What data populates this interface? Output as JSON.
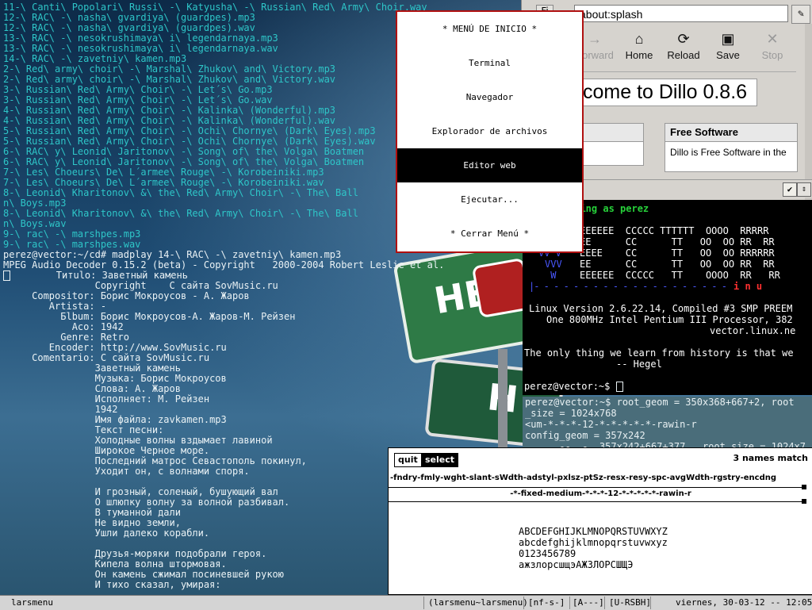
{
  "terminal": {
    "lines": [
      {
        "text": "11-\\ Canti\\ Popolari\\ Russi\\ -\\ Katyusha\\ -\\ Russian\\ Red\\ Army\\ Choir.wav",
        "color": "cyan"
      },
      {
        "text": "12-\\ RAC\\ -\\ nasha\\ gvardiya\\ (guardpes).mp3",
        "color": "cyan"
      },
      {
        "text": "12-\\ RAC\\ -\\ nasha\\ gvardiya\\ (guardpes).wav",
        "color": "cyan"
      },
      {
        "text": "13-\\ RAC\\ -\\ nesokrushimaya\\ i\\ legendarnaya.mp3",
        "color": "cyan"
      },
      {
        "text": "13-\\ RAC\\ -\\ nesokrushimaya\\ i\\ legendarnaya.wav",
        "color": "cyan"
      },
      {
        "text": "14-\\ RAC\\ -\\ zavetniy\\ kamen.mp3",
        "color": "cyan"
      },
      {
        "text": "2-\\ Red\\ army\\ choir\\ -\\ Marshal\\ Zhukov\\ and\\ Victory.mp3",
        "color": "cyan"
      },
      {
        "text": "2-\\ Red\\ army\\ choir\\ -\\ Marshal\\ Zhukov\\ and\\ Victory.wav",
        "color": "cyan"
      },
      {
        "text": "3-\\ Russian\\ Red\\ Army\\ Choir\\ -\\ Let´s\\ Go.mp3",
        "color": "cyan"
      },
      {
        "text": "3-\\ Russian\\ Red\\ Army\\ Choir\\ -\\ Let´s\\ Go.wav",
        "color": "cyan"
      },
      {
        "text": "4-\\ Russian\\ Red\\ Army\\ Choir\\ -\\ Kalinka\\ (Wonderful).mp3",
        "color": "cyan"
      },
      {
        "text": "4-\\ Russian\\ Red\\ Army\\ Choir\\ -\\ Kalinka\\ (Wonderful).wav",
        "color": "cyan"
      },
      {
        "text": "5-\\ Russian\\ Red\\ Army\\ Choir\\ -\\ Ochi\\ Chornye\\ (Dark\\ Eyes).mp3",
        "color": "cyan"
      },
      {
        "text": "5-\\ Russian\\ Red\\ Army\\ Choir\\ -\\ Ochi\\ Chornye\\ (Dark\\ Eyes).wav",
        "color": "cyan"
      },
      {
        "text": "6-\\ RAC\\ y\\ Leonid\\ Jaritonov\\ -\\ Song\\ of\\ the\\ Volga\\ Boatmen",
        "color": "cyan"
      },
      {
        "text": "6-\\ RAC\\ y\\ Leonid\\ Jaritonov\\ -\\ Song\\ of\\ the\\ Volga\\ Boatmen",
        "color": "cyan"
      },
      {
        "text": "7-\\ Les\\ Choeurs\\ De\\ L´armee\\ Rouge\\ -\\ Korobeiniki.mp3",
        "color": "cyan"
      },
      {
        "text": "7-\\ Les\\ Choeurs\\ De\\ L´armee\\ Rouge\\ -\\ Korobeiniki.wav",
        "color": "cyan"
      },
      {
        "text": "8-\\ Leonid\\ Kharitonov\\ &\\ the\\ Red\\ Army\\ Choir\\ -\\ The\\ Ball",
        "color": "cyan"
      },
      {
        "text": "n\\ Boys.mp3",
        "color": "cyan"
      },
      {
        "text": "8-\\ Leonid\\ Kharitonov\\ &\\ the\\ Red\\ Army\\ Choir\\ -\\ The\\ Ball",
        "color": "cyan"
      },
      {
        "text": "n\\ Boys.wav",
        "color": "cyan"
      },
      {
        "text": "9-\\ rac\\ -\\ marshpes.mp3",
        "color": "cyan"
      },
      {
        "text": "9-\\ rac\\ -\\ marshpes.wav",
        "color": "cyan"
      },
      {
        "text": "perez@vector:~/cd# madplay 14-\\ RAC\\ -\\ zavetniy\\ kamen.mp3",
        "color": "white"
      },
      {
        "text": "MPEG Audio Decoder 0.15.2 (beta) - Copyright   2000-2004 Robert Leslie et al.",
        "color": "white"
      },
      {
        "text": "        Титulo: Заветный камень",
        "color": "white",
        "cursor": true
      },
      {
        "text": "                Copyright    С сайта SovMusic.ru",
        "color": "white"
      },
      {
        "text": "     Compositor: Борис Мокроусов - А. Жаров",
        "color": "white"
      },
      {
        "text": "        Artista: -",
        "color": "white"
      },
      {
        "text": "          Бlbum: Борис Мокроусов-А. Жаров-М. Рейзен",
        "color": "white"
      },
      {
        "text": "            Aco: 1942",
        "color": "white"
      },
      {
        "text": "          Genre: Retro",
        "color": "white"
      },
      {
        "text": "        Encoder: http://www.SovMusic.ru",
        "color": "white"
      },
      {
        "text": "     Comentario: С сайта SovMusic.ru",
        "color": "white"
      },
      {
        "text": "                Заветный камень",
        "color": "white"
      },
      {
        "text": "                Музыка: Борис Мокроусов",
        "color": "white"
      },
      {
        "text": "                Слова: А. Жаров",
        "color": "white"
      },
      {
        "text": "                Исполняет: М. Рейзен",
        "color": "white"
      },
      {
        "text": "                1942",
        "color": "white"
      },
      {
        "text": "                Имя файла: zavkamen.mp3",
        "color": "white"
      },
      {
        "text": "                Текст песни:",
        "color": "white"
      },
      {
        "text": "                Холодные волны вздымает лавиной",
        "color": "white"
      },
      {
        "text": "                Широкое Черное море.",
        "color": "white"
      },
      {
        "text": "                Последний матрос Севастополь покинул,",
        "color": "white"
      },
      {
        "text": "                Уходит он, с волнами споря.",
        "color": "white"
      },
      {
        "text": "",
        "color": "white"
      },
      {
        "text": "                И грозный, соленый, бушующий вал",
        "color": "white"
      },
      {
        "text": "                О шлюпку волну за волной разбивал.",
        "color": "white"
      },
      {
        "text": "                В туманной дали",
        "color": "white"
      },
      {
        "text": "                Не видно земли,",
        "color": "white"
      },
      {
        "text": "                Ушли далеко корабли.",
        "color": "white"
      },
      {
        "text": "",
        "color": "white"
      },
      {
        "text": "                Друзья-моряки подобрали героя.",
        "color": "white"
      },
      {
        "text": "                Кипела волна штормовая.",
        "color": "white"
      },
      {
        "text": "                Он камень сжимал посиневшей рукою",
        "color": "white"
      },
      {
        "text": "                И тихо сказал, умирая:",
        "color": "white"
      }
    ]
  },
  "dillo": {
    "menu_label": "Fi",
    "url": "about:splash",
    "clear_icon": "✎",
    "toolbar": [
      {
        "label": "Forward",
        "icon": "→",
        "disabled": true
      },
      {
        "label": "Home",
        "icon": "⌂",
        "disabled": false
      },
      {
        "label": "Reload",
        "icon": "⟳",
        "disabled": false
      },
      {
        "label": "Save",
        "icon": "▣",
        "disabled": false
      },
      {
        "label": "Stop",
        "icon": "✕",
        "disabled": true
      }
    ],
    "welcome": "come to Dillo 0.8.6",
    "free_software_title": "Free Software",
    "free_software_text": "Dillo is Free Software in the",
    "status_check": "✔",
    "status_updown": "⇕"
  },
  "xterm": {
    "working": "rking as perez",
    "banner": [
      "EEEEEE  CCCCC TTTTTT  OOOO  RRRRR",
      "EE      CC      TT   OO  OO RR  RR",
      "EEEE    CC      TT   OO  OO RRRRRR",
      "EE      CC      TT   OO  OO RR  RR",
      "EEEEEE  CCCCC   TT    OOOO  RR   RR"
    ],
    "vv": [
      "V  V",
      "VV V",
      "VVV",
      " W"
    ],
    "linux_row": "i n u",
    "version": "Linux Version 2.6.22.14, Compiled #3 SMP PREEM",
    "cpu": "One 800MHz Intel Pentium III Processor, 382",
    "host": "vector.linux.ne",
    "quote1": "The only thing we learn from history is that we",
    "quote2": "-- Hegel",
    "prompt": "perez@vector:~$ "
  },
  "xterm2": {
    "lines": [
      "perez@vector:~$ root_geom = 350x368+667+2, root",
      "_size = 1024x768",
      "<um-*-*-*-12-*-*-*-*-*-rawin-r",
      "config_geom = 357x242",
      "      --  -  357x242+667+377 . root_size = 1024x7"
    ]
  },
  "xfontsel": {
    "quit": "quit",
    "select": "select",
    "match": "3 names match",
    "pattern": "-fndry-fmly-wght-slant-sWdth-adstyl-pxlsz-ptSz-resx-resy-spc-avgWdth-rgstry-encdng",
    "fontname": "-*-fixed-medium-*-*-*-12-*-*-*-*-*-rawin-r",
    "sample": [
      "ABCDEFGHIJKLMNOPQRSTUVWXYZ",
      "abcdefghijklmnopqrstuvwxyz",
      "0123456789",
      "ажзлорсшщэАЖЗЛОРСШЩЭ"
    ]
  },
  "menu": {
    "title": "*  MENÚ DE INICIO  *",
    "items": [
      "Terminal",
      "Navegador",
      "Explorador de archivos",
      "Editor web",
      "Ejecutar...",
      "*  Cerrar Menú  *"
    ],
    "active_index": 3
  },
  "statusbar": {
    "left": "larsmenu",
    "title": "(larsmenu~larsmenu)",
    "mode1": "[nf-s-]",
    "mode2": "[A---]",
    "mode3": "[U-RSBH]",
    "clock": "viernes, 30-03-12 -- 12:05"
  }
}
